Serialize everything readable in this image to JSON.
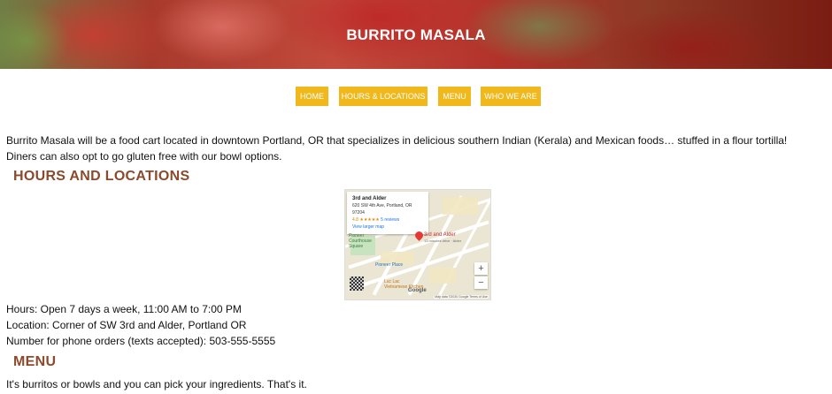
{
  "header": {
    "title": "BURRITO MASALA"
  },
  "nav": {
    "items": [
      {
        "label": "HOME"
      },
      {
        "label": "HOURS & LOCATIONS"
      },
      {
        "label": "MENU"
      },
      {
        "label": "WHO WE ARE"
      }
    ],
    "color": "#f0b81b"
  },
  "intro": {
    "line1": "Burrito Masala will be a food cart located in downtown Portland, OR that specializes in delicious southern Indian (Kerala) and Mexican foods… stuffed in a flour tortilla!",
    "line2": "Diners can also opt to go gluten free with our bowl options."
  },
  "hours_section": {
    "heading": "HOURS AND LOCATIONS",
    "hours": "Hours: Open 7 days a week, 11:00 AM to 7:00 PM",
    "location": "Location: Corner of SW 3rd and Alder, Portland OR",
    "phone": "Number for phone orders (texts accepted): 503-555-5555"
  },
  "map": {
    "place_name": "3rd and Alder",
    "address": "620 SW 4th Ave, Portland, OR 97204",
    "rating": "4.8 ★★★★★",
    "reviews": "5 reviews",
    "larger_map": "View larger map",
    "pin_label": "3rd and Alder",
    "pin_sublabel": "13 minutes drive · Alder",
    "poi_park": "Pioneer\nCourthouse\nSquare",
    "poi_place": "Pioneer Place",
    "poi_restaurant": "Luc Lac\nVietnamese Kitchen",
    "zoom_in": "+",
    "zoom_out": "−",
    "google": "Google",
    "attribution": "Map data ©2020 Google   Terms of Use"
  },
  "menu_section": {
    "heading": "MENU",
    "text": "It's burritos or bowls and you can pick your ingredients. That's it."
  },
  "colors": {
    "heading": "#8b4a2b",
    "nav_button": "#f0b81b"
  }
}
